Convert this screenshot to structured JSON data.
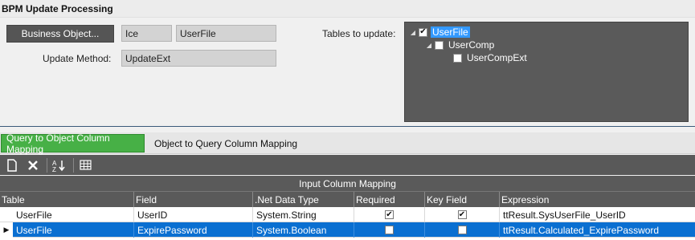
{
  "header": {
    "title": "BPM Update Processing"
  },
  "business_object": {
    "button_label": "Business Object...",
    "namespace": "Ice",
    "name": "UserFile"
  },
  "update_method": {
    "label": "Update Method:",
    "value": "UpdateExt"
  },
  "tables": {
    "label": "Tables to update:",
    "tree": [
      {
        "label": "UserFile",
        "checked": true,
        "selected": true
      },
      {
        "label": "UserComp",
        "checked": false,
        "selected": false
      },
      {
        "label": "UserCompExt",
        "checked": false,
        "selected": false
      }
    ]
  },
  "tabs": [
    {
      "label": "Query to Object Column Mapping",
      "active": true
    },
    {
      "label": "Object to Query Column Mapping",
      "active": false
    }
  ],
  "toolbar": {
    "buttons": [
      "new-icon",
      "delete-icon",
      "sort-az-icon",
      "grid-settings-icon"
    ]
  },
  "grid": {
    "group_header": "Input Column Mapping",
    "columns": [
      "Table",
      "Field",
      ".Net Data Type",
      "Required",
      "Key Field",
      "Expression"
    ],
    "rows": [
      {
        "table": "UserFile",
        "field": "UserID",
        "type": "System.String",
        "required": true,
        "key_field": true,
        "expression": "ttResult.SysUserFile_UserID",
        "selected": false
      },
      {
        "table": "UserFile",
        "field": "ExpirePassword",
        "type": "System.Boolean",
        "required": false,
        "key_field": false,
        "expression": "ttResult.Calculated_ExpirePassword",
        "selected": true
      }
    ]
  },
  "colors": {
    "tab_active": "#47b046",
    "selection": "#0a6fd1",
    "tree_selection": "#3399ff",
    "panel_dark": "#5a5a5a"
  }
}
